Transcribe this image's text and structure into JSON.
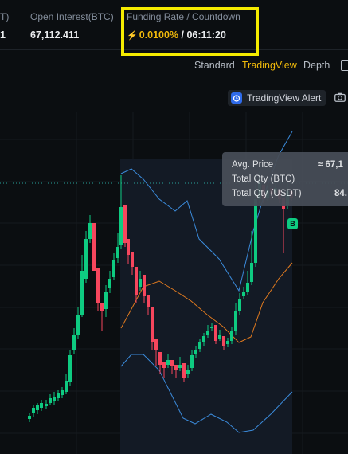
{
  "stats": {
    "prev_label": "T)",
    "prev_value": "1",
    "open_interest_label": "Open Interest(BTC)",
    "open_interest_value": "67,112.411",
    "funding_label": "Funding Rate / Countdown",
    "funding_rate": "0.0100%",
    "funding_sep": " / ",
    "countdown": "06:11:20"
  },
  "view_tabs": {
    "standard": "Standard",
    "tradingview": "TradingView",
    "depth": "Depth",
    "active": "TradingView"
  },
  "alert": {
    "label": "TradingView Alert",
    "icon": "alarm-clock-icon"
  },
  "tooltip": {
    "avg_price_label": "Avg. Price",
    "avg_price_value": "≈ 67,1",
    "total_qty_btc_label": "Total Qty (BTC)",
    "total_qty_btc_value": "",
    "total_qty_usdt_label": "Total Qty (USDT)",
    "total_qty_usdt_value": "84."
  },
  "badge": {
    "label": "B"
  },
  "colors": {
    "up": "#0ecb81",
    "down": "#f6465d",
    "accent": "#f0b90b",
    "boll_band": "#3b8bdb",
    "boll_mid": "#e07a1f",
    "highlight": "#f5eb00"
  }
}
